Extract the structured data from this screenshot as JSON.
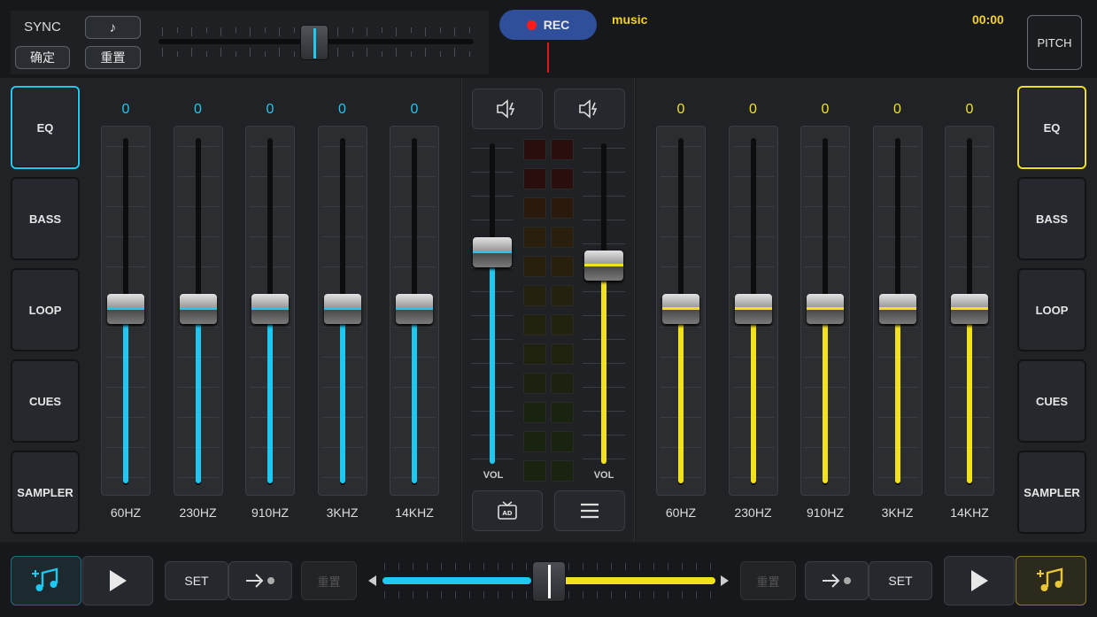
{
  "top": {
    "sync_label": "SYNC",
    "confirm_label": "确定",
    "reset_label": "重置",
    "rec_label": "REC",
    "track_name": "music",
    "time": "00:00",
    "pitch_label": "PITCH"
  },
  "left_deck": {
    "buttons": [
      "EQ",
      "BASS",
      "LOOP",
      "CUES",
      "SAMPLER"
    ],
    "bands": [
      {
        "freq": "60HZ",
        "value": "0"
      },
      {
        "freq": "230HZ",
        "value": "0"
      },
      {
        "freq": "910HZ",
        "value": "0"
      },
      {
        "freq": "3KHZ",
        "value": "0"
      },
      {
        "freq": "14KHZ",
        "value": "0"
      }
    ]
  },
  "right_deck": {
    "buttons": [
      "EQ",
      "BASS",
      "LOOP",
      "CUES",
      "SAMPLER"
    ],
    "bands": [
      {
        "freq": "60HZ",
        "value": "0"
      },
      {
        "freq": "230HZ",
        "value": "0"
      },
      {
        "freq": "910HZ",
        "value": "0"
      },
      {
        "freq": "3KHZ",
        "value": "0"
      },
      {
        "freq": "14KHZ",
        "value": "0"
      }
    ]
  },
  "mixer": {
    "vol_left_label": "VOL",
    "vol_right_label": "VOL",
    "vol_left_level": 0.66,
    "vol_right_level": 0.62
  },
  "bottom": {
    "set_left": "SET",
    "set_right": "SET",
    "reset_left": "重置",
    "reset_right": "重置",
    "crossfader_position": 0.5
  },
  "colors": {
    "left_accent": "#1ec8f0",
    "right_accent": "#f2e21e",
    "rec_button": "#2f4f9a",
    "rec_dot": "#ff1a1a",
    "track_name": "#f2d21e"
  },
  "icons": {
    "note": "music-note-icon",
    "speaker_left": "speaker-icon",
    "speaker_right": "speaker-icon",
    "ad": "tv-ad-icon",
    "menu": "hamburger-menu-icon",
    "play": "play-icon",
    "add_music": "add-music-icon"
  }
}
